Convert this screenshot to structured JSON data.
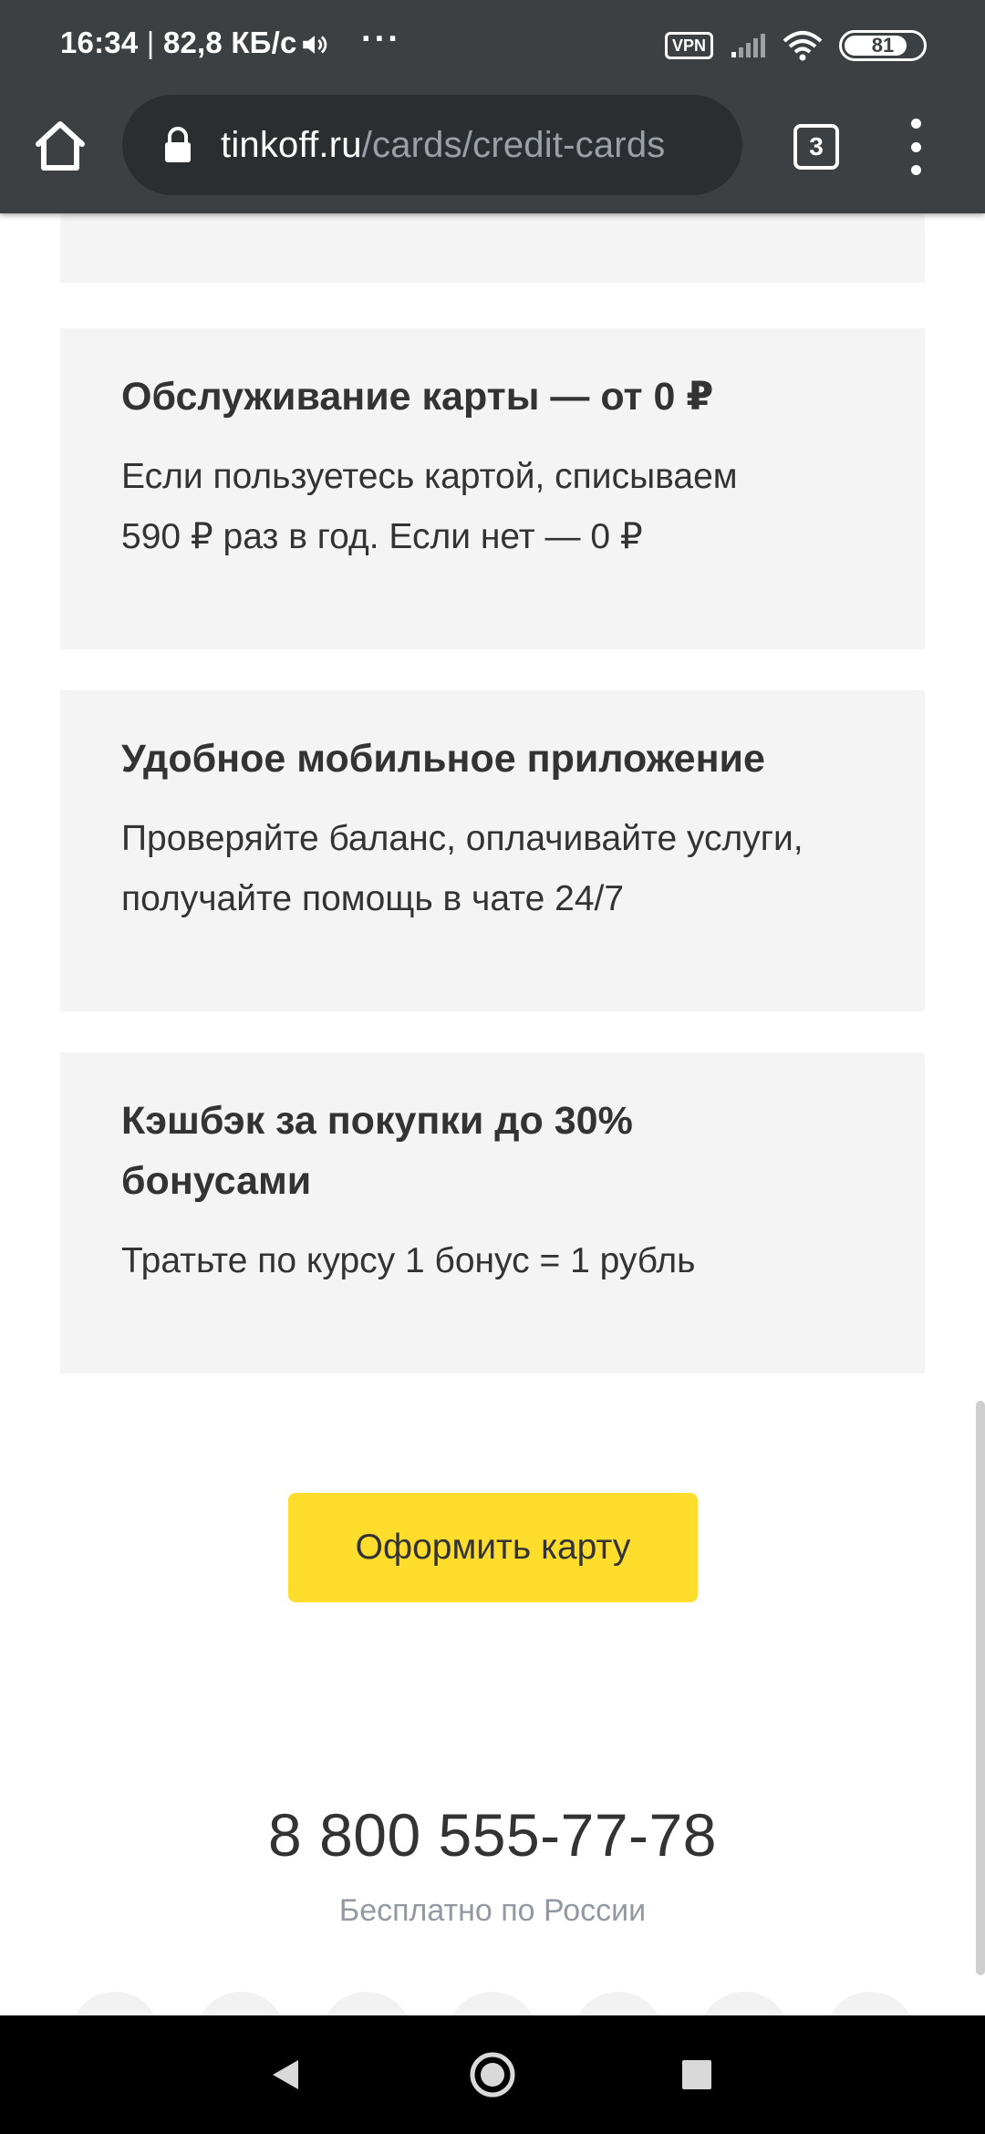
{
  "status_bar": {
    "time": "16:34",
    "separator": "|",
    "network_speed": "82,8 КБ/с",
    "more_indicator": "···",
    "vpn_label": "VPN",
    "battery_level": "81",
    "battery_fraction": 0.81
  },
  "browser": {
    "url_host": "tinkoff.ru",
    "url_path": "/cards/credit-cards",
    "tab_count": "3"
  },
  "features": [
    {
      "title": "Обслуживание карты — от 0 ₽",
      "text_line1": "Если пользуетесь картой, списываем",
      "text_line2": "590 ₽ раз в год. Если нет — 0 ₽"
    },
    {
      "title": "Удобное мобильное приложение",
      "text_line1": "Проверяйте баланс, оплачивайте услуги,",
      "text_line2": "получайте помощь в чате 24/7"
    },
    {
      "title_line1": "Кэшбэк за покупки до 30%",
      "title_line2": "бонусами",
      "text": "Тратьте по курсу 1 бонус = 1 рубль"
    }
  ],
  "cta": {
    "label": "Оформить карту"
  },
  "contact": {
    "phone": "8 800 555-77-78",
    "phone_note": "Бесплатно по России"
  },
  "colors": {
    "chrome_bg": "#3c4043",
    "card_bg": "#f4f4f4",
    "cta_bg": "#ffdd2d",
    "text": "#333333",
    "muted_text": "#9299a2"
  },
  "icons": {
    "home": "home-icon",
    "lock": "lock-icon",
    "menu": "more-vert-icon",
    "back": "back-triangle-icon",
    "home_nav": "home-circle-icon",
    "recents": "recents-square-icon"
  }
}
